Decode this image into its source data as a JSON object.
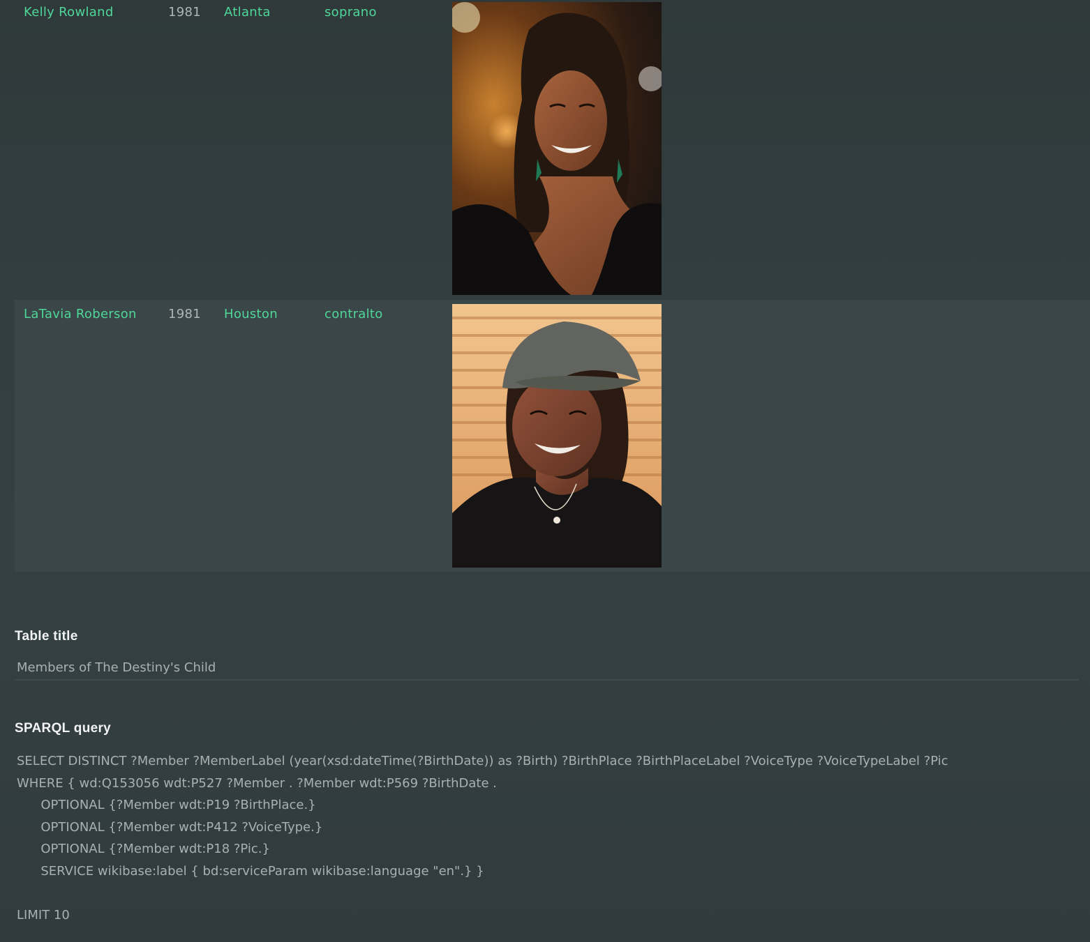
{
  "table": {
    "rows": [
      {
        "name": "Kelly Rowland",
        "year": "1981",
        "place": "Atlanta",
        "voice": "soprano",
        "pic": "portrait-photo"
      },
      {
        "name": "LaTavia Roberson",
        "year": "1981",
        "place": "Houston",
        "voice": "contralto",
        "pic": "portrait-photo"
      }
    ]
  },
  "form": {
    "title_label": "Table title",
    "title_value": "Members of The Destiny's Child",
    "query_label": "SPARQL query",
    "query_text": "SELECT DISTINCT ?Member ?MemberLabel (year(xsd:dateTime(?BirthDate)) as ?Birth) ?BirthPlace ?BirthPlaceLabel ?VoiceType ?VoiceTypeLabel ?Pic\nWHERE { wd:Q153056 wdt:P527 ?Member . ?Member wdt:P569 ?BirthDate .\n      OPTIONAL {?Member wdt:P19 ?BirthPlace.}\n      OPTIONAL {?Member wdt:P412 ?VoiceType.}\n      OPTIONAL {?Member wdt:P18 ?Pic.}\n      SERVICE wikibase:label { bd:serviceParam wikibase:language \"en\".} }\n\nLIMIT 10"
  },
  "colors": {
    "background": "#313b3c",
    "row_alt": "#3a4647",
    "link": "#4fd79a",
    "text": "#a9b0b1",
    "label": "#f2f4f4"
  }
}
